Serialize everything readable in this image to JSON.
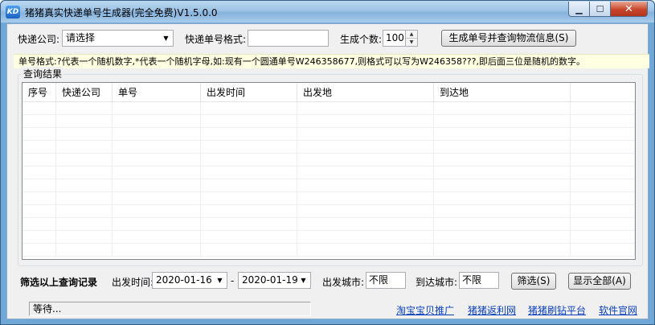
{
  "window": {
    "title": "猪猪真实快递单号生成器(完全免费)V1.5.0.0",
    "icon_label": "KD",
    "minimize_glyph": "▁",
    "maximize_glyph": "☐",
    "close_glyph": "✕"
  },
  "form": {
    "company_label": "快递公司:",
    "company_value": "请选择",
    "format_label": "快递单号格式:",
    "format_value": "",
    "count_label": "生成个数:",
    "count_value": "100",
    "generate_button": "生成单号并查询物流信息(S)"
  },
  "hint": "单号格式:?代表一个随机数字,*代表一个随机字母,如:现有一个圆通单号W246358677,则格式可以写为W246358???,即后面三位是随机的数字。",
  "results": {
    "group_title": "查询结果",
    "columns": [
      "序号",
      "快递公司",
      "单号",
      "出发时间",
      "出发地",
      "到达地",
      ""
    ]
  },
  "filter": {
    "title": "筛选以上查询记录",
    "time_label": "出发时间:",
    "start_date": "2020-01-16",
    "dash": "-",
    "end_date": "2020-01-19",
    "from_city_label": "出发城市:",
    "from_city_value": "不限",
    "to_city_label": "到达城市:",
    "to_city_value": "不限",
    "filter_button": "筛选(S)",
    "show_all_button": "显示全部(A)"
  },
  "status": "等待...",
  "links": [
    "淘宝宝贝推广",
    "猪猪返利网",
    "猪猪刷钻平台",
    "软件官网"
  ]
}
